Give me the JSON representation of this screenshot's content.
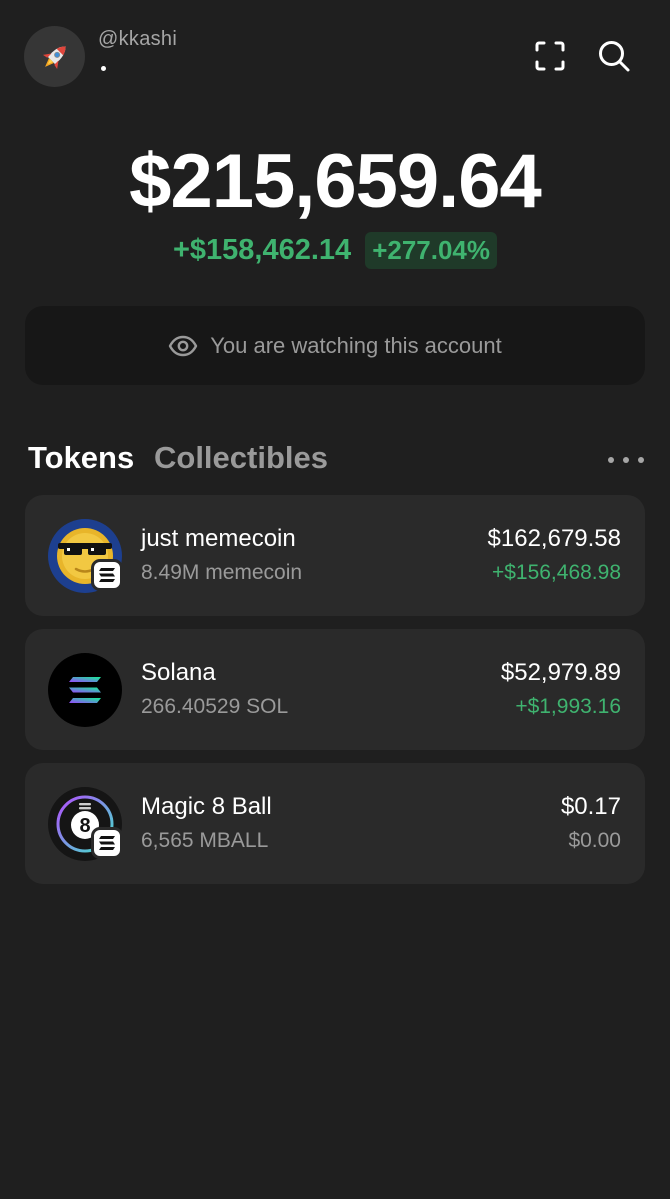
{
  "header": {
    "username": "@kkashi",
    "avatar_icon": "rocket-icon",
    "scan_icon": "scan-icon",
    "search_icon": "search-icon"
  },
  "balance": {
    "total": "$215,659.64",
    "change_amount": "+$158,462.14",
    "change_percent": "+277.04%"
  },
  "watch_banner": {
    "icon": "eye-icon",
    "text": "You are watching this account"
  },
  "tabs": {
    "tokens": "Tokens",
    "collectibles": "Collectibles",
    "active": "tokens"
  },
  "tokens": [
    {
      "name": "just memecoin",
      "amount": "8.49M memecoin",
      "value": "$162,679.58",
      "change": "+$156,468.98",
      "change_color": "#3fb36f",
      "icon": "memecoin-icon"
    },
    {
      "name": "Solana",
      "amount": "266.40529 SOL",
      "value": "$52,979.89",
      "change": "+$1,993.16",
      "change_color": "#3fb36f",
      "icon": "solana-icon"
    },
    {
      "name": "Magic 8 Ball",
      "amount": "6,565 MBALL",
      "value": "$0.17",
      "change": "$0.00",
      "change_color": "#9a9a9a",
      "icon": "magic-8-ball-icon"
    }
  ],
  "colors": {
    "background": "#1f1f1f",
    "card": "#2a2a2a",
    "positive": "#3fb36f",
    "muted": "#9a9a9a"
  }
}
